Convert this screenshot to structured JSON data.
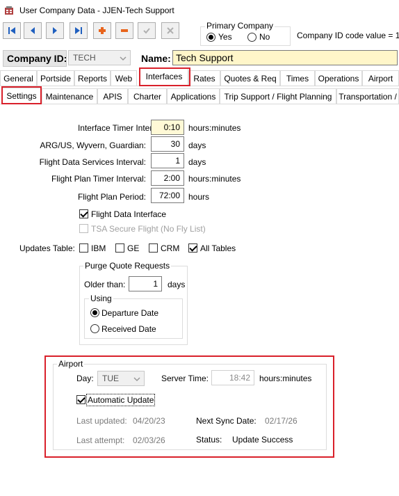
{
  "window": {
    "title": "User Company Data - JJEN-Tech Support"
  },
  "primary_company": {
    "legend": "Primary Company",
    "yes_label": "Yes",
    "no_label": "No",
    "selected": "Yes"
  },
  "company_id_code": "Company ID code value = 1",
  "header": {
    "company_id_label": "Company ID:",
    "company_id_value": "TECH",
    "name_label": "Name:",
    "name_value": "Tech Support"
  },
  "tabs_row1": [
    "General",
    "Portside",
    "Reports",
    "Web",
    "Interfaces",
    "Rates",
    "Quotes & Req",
    "Times",
    "Operations",
    "Airport"
  ],
  "tabs_row2": [
    "Settings",
    "Maintenance",
    "APIS",
    "Charter",
    "Applications",
    "Trip Support / Flight Planning",
    "Transportation /"
  ],
  "active_tab_row1": "Interfaces",
  "active_tab_row2": "Settings",
  "settings": {
    "interface_timer": {
      "label": "Interface Timer Interval:",
      "value": "0:10",
      "unit": "hours:minutes"
    },
    "arg_us": {
      "label": "ARG/US, Wyvern, Guardian:",
      "value": "30",
      "unit": "days"
    },
    "flight_data_services": {
      "label": "Flight Data Services Interval:",
      "value": "1",
      "unit": "days"
    },
    "flight_plan_timer": {
      "label": "Flight Plan Timer Interval:",
      "value": "2:00",
      "unit": "hours:minutes"
    },
    "flight_plan_period": {
      "label": "Flight Plan Period:",
      "value": "72:00",
      "unit": "hours"
    },
    "flight_data_interface": {
      "label": "Flight Data Interface",
      "checked": true
    },
    "tsa_secure_flight": {
      "label": "TSA Secure Flight (No Fly List)",
      "checked": false
    }
  },
  "updates_table": {
    "label": "Updates Table:",
    "options": [
      {
        "label": "IBM",
        "checked": false
      },
      {
        "label": "GE",
        "checked": false
      },
      {
        "label": "CRM",
        "checked": false
      },
      {
        "label": "All Tables",
        "checked": true
      }
    ]
  },
  "purge": {
    "legend": "Purge Quote Requests",
    "older_than_label": "Older than:",
    "older_than_value": "1",
    "unit": "days",
    "using_legend": "Using",
    "departure_label": "Departure Date",
    "received_label": "Received Date",
    "selected": "Departure Date"
  },
  "airport": {
    "legend": "Airport",
    "day_label": "Day:",
    "day_value": "TUE",
    "server_time_label": "Server Time:",
    "server_time_value": "18:42",
    "server_time_unit": "hours:minutes",
    "automatic_update_label": "Automatic Update",
    "automatic_update_checked": true,
    "last_updated_label": "Last updated:",
    "last_updated_value": "04/20/23",
    "next_sync_label": "Next Sync Date:",
    "next_sync_value": "02/17/26",
    "last_attempt_label": "Last attempt:",
    "last_attempt_value": "02/03/26",
    "status_label": "Status:",
    "status_value": "Update Success"
  },
  "colors": {
    "highlight_red": "#d9202a",
    "nav_blue": "#1f5fbf",
    "nav_orange": "#e8641c",
    "field_yellow": "#fff9d6"
  }
}
